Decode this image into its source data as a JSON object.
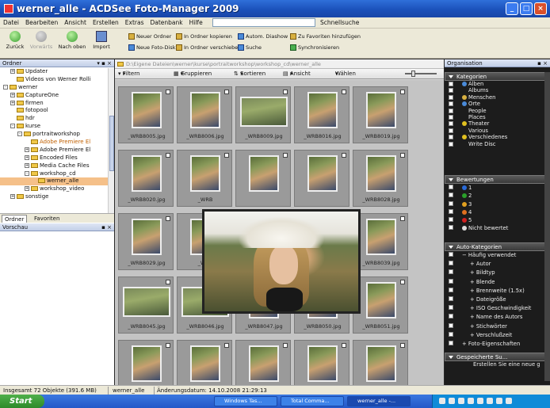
{
  "window": {
    "title": "werner_alle - ACDSee Foto-Manager 2009"
  },
  "menu": [
    "Datei",
    "Bearbeiten",
    "Ansicht",
    "Erstellen",
    "Extras",
    "Datenbank",
    "Hilfe"
  ],
  "quick_search": "Schnellsuche",
  "toolbar": {
    "back": "Zurück",
    "forward": "Vorwärts",
    "up": "Nach oben",
    "import": "Import",
    "new_folder": "Neuer Ordner",
    "new_photo_disc": "Neue Foto-Disk",
    "copy_to_folder": "In Ordner kopieren",
    "move_to_folder": "In Ordner verschieben",
    "auto_slideshow": "Autom. Diashow",
    "search": "Suche",
    "add_favorites": "Zu Favoriten hinzufügen",
    "synchronize": "Synchronisieren"
  },
  "left": {
    "folder_title": "Ordner",
    "tree": [
      {
        "label": "Updater",
        "level": 1,
        "exp": "+"
      },
      {
        "label": "Videos von Werner Rolli",
        "level": 1,
        "exp": ""
      },
      {
        "label": "werner",
        "level": 0,
        "exp": "-"
      },
      {
        "label": "CaptureOne",
        "level": 1,
        "exp": "+"
      },
      {
        "label": "firmen",
        "level": 1,
        "exp": "+"
      },
      {
        "label": "fotopool",
        "level": 1,
        "exp": ""
      },
      {
        "label": "hdr",
        "level": 1,
        "exp": ""
      },
      {
        "label": "kurse",
        "level": 1,
        "exp": "-"
      },
      {
        "label": "portraitworkshop",
        "level": 2,
        "exp": "-"
      },
      {
        "label": "Adobe Premiere El",
        "level": 3,
        "exp": "",
        "hl": true
      },
      {
        "label": "Adobe Premiere El",
        "level": 3,
        "exp": "+"
      },
      {
        "label": "Encoded Files",
        "level": 3,
        "exp": "+"
      },
      {
        "label": "Media Cache Files",
        "level": 3,
        "exp": "+"
      },
      {
        "label": "workshop_cd",
        "level": 3,
        "exp": "-"
      },
      {
        "label": "werner_alle",
        "level": 4,
        "exp": "",
        "sel": true
      },
      {
        "label": "workshop_video",
        "level": 3,
        "exp": "+"
      },
      {
        "label": "sonstige",
        "level": 1,
        "exp": "+"
      }
    ],
    "tab_folder": "Ordner",
    "tab_favorites": "Favoriten",
    "preview_title": "Vorschau"
  },
  "center": {
    "path": "D:\\Eigene Dateien\\werner\\kurse\\portraitworkshop\\workshop_cd\\werner_alle",
    "filter": "Filtern nach",
    "group": "Gruppieren nach",
    "sort": "Sortieren",
    "view": "Ansicht",
    "select": "Wählen",
    "tiles": [
      {
        "name": "_WRB8005.jpg",
        "land": false
      },
      {
        "name": "_WRB8006.jpg",
        "land": false
      },
      {
        "name": "_WRB8009.jpg",
        "land": true
      },
      {
        "name": "_WRB8016.jpg",
        "land": false
      },
      {
        "name": "_WRB8019.jpg",
        "land": false
      },
      {
        "name": "_WRB8020.jpg",
        "land": false
      },
      {
        "name": "_WRB",
        "land": false
      },
      {
        "name": "",
        "land": false
      },
      {
        "name": "",
        "land": false
      },
      {
        "name": "_WRB8028.jpg",
        "land": false
      },
      {
        "name": "_WRB8029.jpg",
        "land": false
      },
      {
        "name": "_WRB",
        "land": false
      },
      {
        "name": "",
        "land": false
      },
      {
        "name": "",
        "land": false
      },
      {
        "name": "_WRB8039.jpg",
        "land": false
      },
      {
        "name": "_WRB8045.jpg",
        "land": true
      },
      {
        "name": "_WRB8046.jpg",
        "land": true
      },
      {
        "name": "_WRB8047.jpg",
        "land": false
      },
      {
        "name": "_WRB8050.jpg",
        "land": false
      },
      {
        "name": "_WRB8051.jpg",
        "land": false
      },
      {
        "name": "",
        "land": false
      },
      {
        "name": "",
        "land": false
      },
      {
        "name": "",
        "land": false
      },
      {
        "name": "",
        "land": false
      },
      {
        "name": "",
        "land": false
      }
    ]
  },
  "right": {
    "title": "Organisation",
    "categories_title": "Kategorien",
    "categories": [
      "Alben",
      "Albums",
      "Menschen",
      "Orte",
      "People",
      "Places",
      "Theater",
      "Various",
      "Verschiedenes",
      "Write Disc"
    ],
    "ratings_title": "Bewertungen",
    "ratings": [
      "1",
      "2",
      "3",
      "4",
      "5",
      "Nicht bewertet"
    ],
    "rating_colors": [
      "#2a6ad8",
      "#2aa02a",
      "#e0a020",
      "#e07020",
      "#d02020",
      "#dddddd"
    ],
    "auto_title": "Auto-Kategorien",
    "auto": [
      "Häufig verwendet",
      "Autor",
      "Bildtyp",
      "Blende",
      "Brennweite (1.5x)",
      "Dateigröße",
      "ISO Geschwindigkeit",
      "Name des Autors",
      "Stichwörter",
      "Verschlußzeit",
      "Foto-Eigenschaften"
    ],
    "saved_title": "Gespeicherte Su...",
    "saved_hint": "Erstellen Sie eine neue g"
  },
  "status": {
    "total": "Insgesamt 72 Objekte  (391.6 MB)",
    "folder": "werner_alle",
    "changed": "Änderungsdatum: 14.10.2008 21:29:13"
  },
  "taskbar": {
    "start": "Start",
    "tasks": [
      "Windows Tas...",
      "Total Comma...",
      "werner_alle -..."
    ]
  }
}
